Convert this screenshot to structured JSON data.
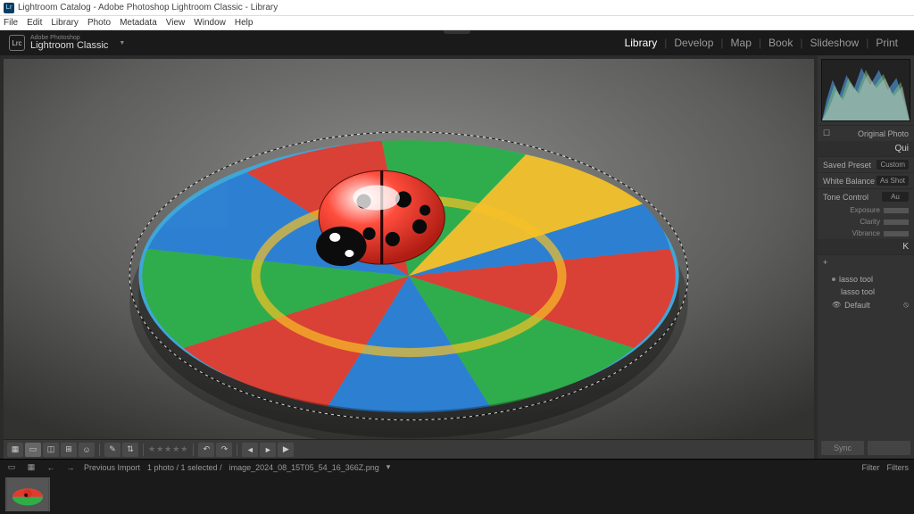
{
  "window": {
    "title": "Lightroom Catalog - Adobe Photoshop Lightroom Classic - Library",
    "app_icon_label": "Lr"
  },
  "menu": [
    "File",
    "Edit",
    "Library",
    "Photo",
    "Metadata",
    "View",
    "Window",
    "Help"
  ],
  "brand": {
    "icon": "Lrc",
    "small": "Adobe Photoshop",
    "big": "Lightroom Classic",
    "dropdown_glyph": "▼"
  },
  "modules": [
    "Library",
    "Develop",
    "Map",
    "Book",
    "Slideshow",
    "Print"
  ],
  "active_module": "Library",
  "right_panel": {
    "original_photo_label": "Original Photo",
    "quick_header": "Qui",
    "saved_preset": {
      "label": "Saved Preset",
      "value": "Custom"
    },
    "white_balance": {
      "label": "White Balance",
      "value": "As Shot"
    },
    "tone_control": {
      "label": "Tone Control",
      "value": "Au"
    },
    "sliders": [
      {
        "label": "Exposure"
      },
      {
        "label": "Clarity"
      },
      {
        "label": "Vibrance"
      }
    ],
    "k_header": "K",
    "tree": {
      "plus": "+",
      "items": [
        "lasso tool",
        "lasso tool"
      ],
      "default": "Default"
    },
    "sync": {
      "btn1": "Sync",
      "btn2": ""
    }
  },
  "toolbar": {
    "stars": "★★★★★"
  },
  "status_bar": {
    "previous_import": "Previous Import",
    "count": "1 photo / 1 selected /",
    "filename": "image_2024_08_15T05_54_16_366Z.png",
    "tri": "▾",
    "filter": "Filter",
    "filters": "Filters"
  }
}
